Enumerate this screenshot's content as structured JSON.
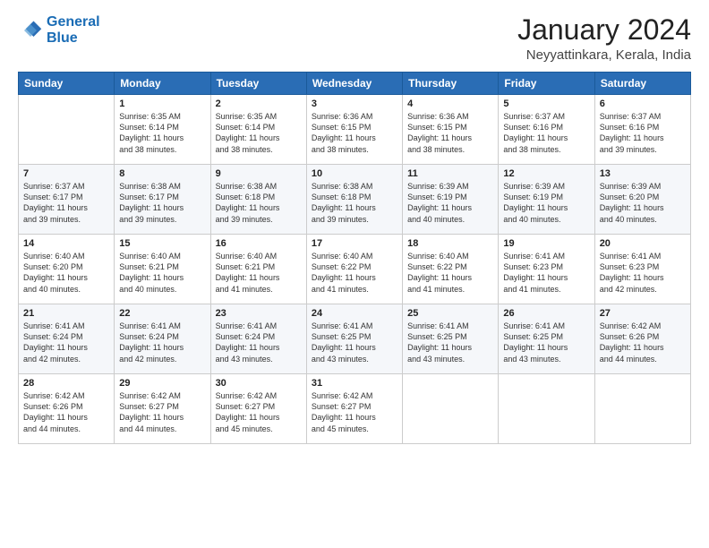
{
  "header": {
    "logo_line1": "General",
    "logo_line2": "Blue",
    "title": "January 2024",
    "subtitle": "Neyyattinkara, Kerala, India"
  },
  "weekdays": [
    "Sunday",
    "Monday",
    "Tuesday",
    "Wednesday",
    "Thursday",
    "Friday",
    "Saturday"
  ],
  "weeks": [
    [
      {
        "day": "",
        "info": ""
      },
      {
        "day": "1",
        "info": "Sunrise: 6:35 AM\nSunset: 6:14 PM\nDaylight: 11 hours\nand 38 minutes."
      },
      {
        "day": "2",
        "info": "Sunrise: 6:35 AM\nSunset: 6:14 PM\nDaylight: 11 hours\nand 38 minutes."
      },
      {
        "day": "3",
        "info": "Sunrise: 6:36 AM\nSunset: 6:15 PM\nDaylight: 11 hours\nand 38 minutes."
      },
      {
        "day": "4",
        "info": "Sunrise: 6:36 AM\nSunset: 6:15 PM\nDaylight: 11 hours\nand 38 minutes."
      },
      {
        "day": "5",
        "info": "Sunrise: 6:37 AM\nSunset: 6:16 PM\nDaylight: 11 hours\nand 38 minutes."
      },
      {
        "day": "6",
        "info": "Sunrise: 6:37 AM\nSunset: 6:16 PM\nDaylight: 11 hours\nand 39 minutes."
      }
    ],
    [
      {
        "day": "7",
        "info": ""
      },
      {
        "day": "8",
        "info": "Sunrise: 6:38 AM\nSunset: 6:17 PM\nDaylight: 11 hours\nand 39 minutes."
      },
      {
        "day": "9",
        "info": "Sunrise: 6:38 AM\nSunset: 6:18 PM\nDaylight: 11 hours\nand 39 minutes."
      },
      {
        "day": "10",
        "info": "Sunrise: 6:38 AM\nSunset: 6:18 PM\nDaylight: 11 hours\nand 39 minutes."
      },
      {
        "day": "11",
        "info": "Sunrise: 6:39 AM\nSunset: 6:19 PM\nDaylight: 11 hours\nand 40 minutes."
      },
      {
        "day": "12",
        "info": "Sunrise: 6:39 AM\nSunset: 6:19 PM\nDaylight: 11 hours\nand 40 minutes."
      },
      {
        "day": "13",
        "info": "Sunrise: 6:39 AM\nSunset: 6:20 PM\nDaylight: 11 hours\nand 40 minutes."
      }
    ],
    [
      {
        "day": "14",
        "info": ""
      },
      {
        "day": "15",
        "info": "Sunrise: 6:40 AM\nSunset: 6:21 PM\nDaylight: 11 hours\nand 40 minutes."
      },
      {
        "day": "16",
        "info": "Sunrise: 6:40 AM\nSunset: 6:21 PM\nDaylight: 11 hours\nand 41 minutes."
      },
      {
        "day": "17",
        "info": "Sunrise: 6:40 AM\nSunset: 6:22 PM\nDaylight: 11 hours\nand 41 minutes."
      },
      {
        "day": "18",
        "info": "Sunrise: 6:40 AM\nSunset: 6:22 PM\nDaylight: 11 hours\nand 41 minutes."
      },
      {
        "day": "19",
        "info": "Sunrise: 6:41 AM\nSunset: 6:23 PM\nDaylight: 11 hours\nand 41 minutes."
      },
      {
        "day": "20",
        "info": "Sunrise: 6:41 AM\nSunset: 6:23 PM\nDaylight: 11 hours\nand 42 minutes."
      }
    ],
    [
      {
        "day": "21",
        "info": ""
      },
      {
        "day": "22",
        "info": "Sunrise: 6:41 AM\nSunset: 6:24 PM\nDaylight: 11 hours\nand 42 minutes."
      },
      {
        "day": "23",
        "info": "Sunrise: 6:41 AM\nSunset: 6:24 PM\nDaylight: 11 hours\nand 43 minutes."
      },
      {
        "day": "24",
        "info": "Sunrise: 6:41 AM\nSunset: 6:25 PM\nDaylight: 11 hours\nand 43 minutes."
      },
      {
        "day": "25",
        "info": "Sunrise: 6:41 AM\nSunset: 6:25 PM\nDaylight: 11 hours\nand 43 minutes."
      },
      {
        "day": "26",
        "info": "Sunrise: 6:41 AM\nSunset: 6:25 PM\nDaylight: 11 hours\nand 43 minutes."
      },
      {
        "day": "27",
        "info": "Sunrise: 6:42 AM\nSunset: 6:26 PM\nDaylight: 11 hours\nand 44 minutes."
      }
    ],
    [
      {
        "day": "28",
        "info": "Sunrise: 6:42 AM\nSunset: 6:26 PM\nDaylight: 11 hours\nand 44 minutes."
      },
      {
        "day": "29",
        "info": "Sunrise: 6:42 AM\nSunset: 6:27 PM\nDaylight: 11 hours\nand 44 minutes."
      },
      {
        "day": "30",
        "info": "Sunrise: 6:42 AM\nSunset: 6:27 PM\nDaylight: 11 hours\nand 45 minutes."
      },
      {
        "day": "31",
        "info": "Sunrise: 6:42 AM\nSunset: 6:27 PM\nDaylight: 11 hours\nand 45 minutes."
      },
      {
        "day": "",
        "info": ""
      },
      {
        "day": "",
        "info": ""
      },
      {
        "day": "",
        "info": ""
      }
    ]
  ],
  "week1_day7_info": "Sunrise: 6:37 AM\nSunset: 6:17 PM\nDaylight: 11 hours\nand 39 minutes.",
  "week2_day14_info": "Sunrise: 6:40 AM\nSunset: 6:20 PM\nDaylight: 11 hours\nand 40 minutes.",
  "week3_day21_info": "Sunrise: 6:41 AM\nSunset: 6:24 PM\nDaylight: 11 hours\nand 42 minutes."
}
